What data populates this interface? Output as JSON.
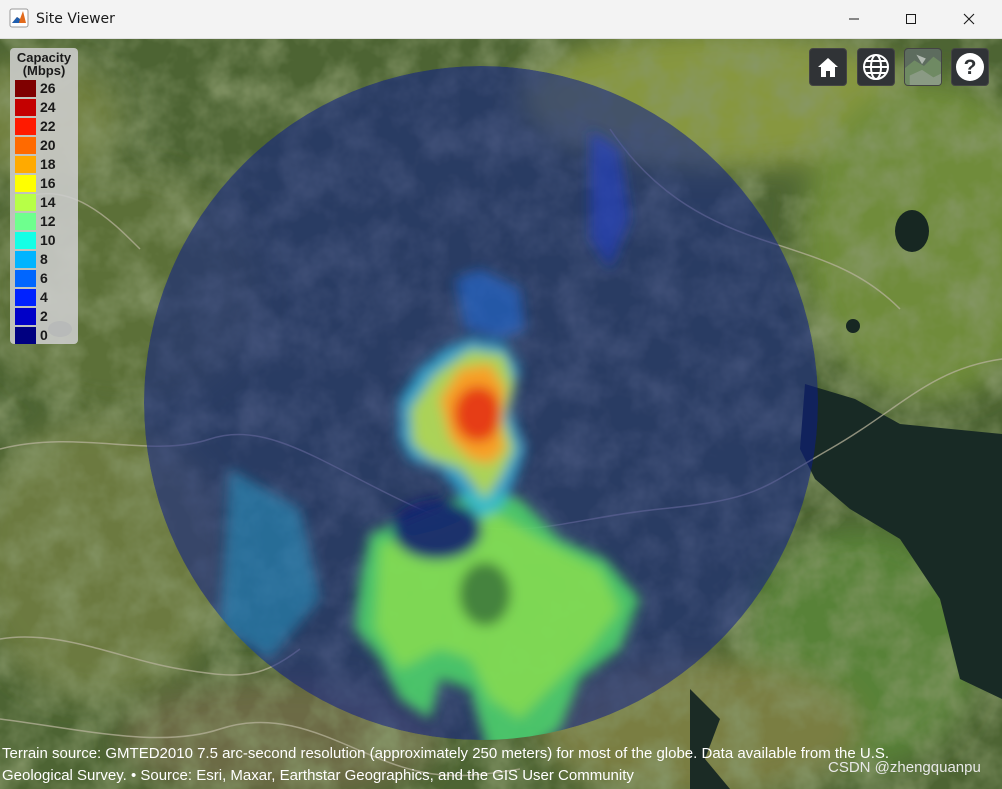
{
  "window": {
    "title": "Site Viewer",
    "minimize_icon": "minimize-icon",
    "maximize_icon": "maximize-icon",
    "close_icon": "close-icon"
  },
  "legend": {
    "title_line1": "Capacity",
    "title_line2": "(Mbps)",
    "items": [
      {
        "label": "26",
        "color": "#7f0000"
      },
      {
        "label": "24",
        "color": "#c40000"
      },
      {
        "label": "22",
        "color": "#ff1a00"
      },
      {
        "label": "20",
        "color": "#ff6a00"
      },
      {
        "label": "18",
        "color": "#ffaa00"
      },
      {
        "label": "16",
        "color": "#ffff00"
      },
      {
        "label": "14",
        "color": "#b7ff47"
      },
      {
        "label": "12",
        "color": "#6eff8e"
      },
      {
        "label": "10",
        "color": "#14ffe6"
      },
      {
        "label": "8",
        "color": "#00b4ff"
      },
      {
        "label": "6",
        "color": "#0066ff"
      },
      {
        "label": "4",
        "color": "#0022ff"
      },
      {
        "label": "2",
        "color": "#0000c8"
      },
      {
        "label": "0",
        "color": "#000080"
      }
    ]
  },
  "toolbar": {
    "home_icon": "home-icon",
    "globe_icon": "globe-icon",
    "basemap_icon": "basemap-icon",
    "help_icon": "help-icon"
  },
  "attribution": {
    "line1": "Terrain source: GMTED2010 7.5 arc-second resolution (approximately 250 meters) for most of the globe. Data available from the U.S.",
    "line2": "Geological Survey. • Source: Esri, Maxar, Earthstar Geographics, and the GIS User Community"
  },
  "watermark": "CSDN @zhengquanpu"
}
